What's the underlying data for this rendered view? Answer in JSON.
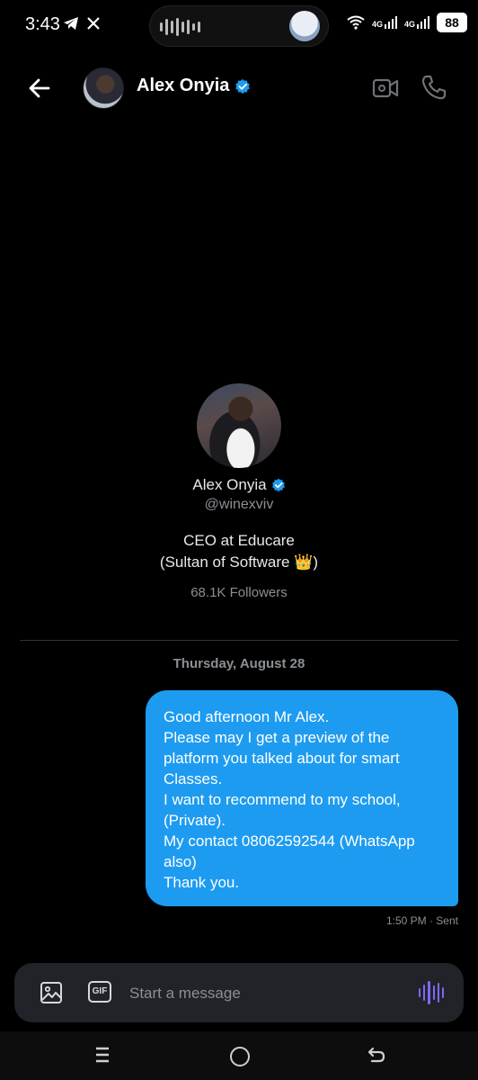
{
  "status_bar": {
    "time": "3:43",
    "network_1": "4G",
    "network_2": "4G",
    "battery": "88"
  },
  "header": {
    "name": "Alex Onyia",
    "verified": true
  },
  "profile": {
    "name": "Alex Onyia",
    "handle": "@winexviv",
    "bio_line_1": "CEO at Educare",
    "bio_line_2": "(Sultan of Software 👑)",
    "followers": "68.1K Followers"
  },
  "conversation": {
    "date_separator": "Thursday, August 28",
    "messages": [
      {
        "lines": [
          "Good afternoon Mr Alex.",
          "Please may I get a preview of the",
          "platform you talked about for smart",
          "Classes.",
          "I want to recommend to my school,",
          "(Private).",
          "My contact 08062592544 (WhatsApp",
          "also)",
          "Thank you."
        ],
        "meta": "1:50 PM · Sent"
      }
    ]
  },
  "composer": {
    "placeholder": "Start a message",
    "gif_label": "GIF"
  },
  "colors": {
    "accent": "#1d9bf0",
    "verified": "#1d9bf0",
    "voice": "#7f67f5"
  },
  "icons": [
    "back-arrow-icon",
    "video-call-icon",
    "phone-icon",
    "image-icon",
    "gif-icon",
    "voice-message-icon",
    "recents-icon",
    "home-icon",
    "back-nav-icon"
  ]
}
